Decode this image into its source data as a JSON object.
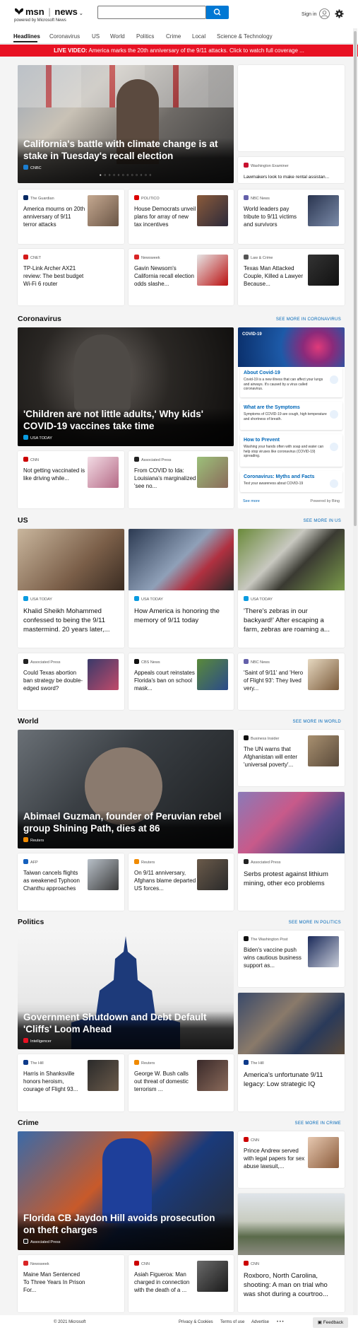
{
  "header": {
    "brand": "msn",
    "section": "news",
    "powered_by": "powered by Microsoft News",
    "search_placeholder": "",
    "sign_in": "Sign in"
  },
  "nav": {
    "items": [
      "Headlines",
      "Coronavirus",
      "US",
      "World",
      "Politics",
      "Crime",
      "Local",
      "Science & Technology"
    ]
  },
  "breaking": {
    "label": "LIVE VIDEO:",
    "text": "America marks the 20th anniversary of the 9/11 attacks. Click to watch full coverage ..."
  },
  "headlines": {
    "hero": {
      "title": "California's battle with climate change is at stake in Tuesday's recall election",
      "source": "CNBC"
    },
    "side": {
      "source": "Washington Examiner",
      "title": "Lawmakers look to make rental assistan..."
    },
    "cards": [
      {
        "source": "The Guardian",
        "title": "America mourns on 20th anniversary of 9/11 terror attacks"
      },
      {
        "source": "POLITICO",
        "title": "House Democrats unveil plans for array of new tax incentives"
      },
      {
        "source": "NBC News",
        "title": "World leaders pay tribute to 9/11 victims and survivors"
      },
      {
        "source": "CNET",
        "title": "TP-Link Archer AX21 review: The best budget Wi-Fi 6 router"
      },
      {
        "source": "Newsweek",
        "title": "Gavin Newsom's California recall election odds slashe..."
      },
      {
        "source": "Law & Crime",
        "title": "Texas Man Attacked Couple, Killed a Lawyer Because..."
      }
    ]
  },
  "coronavirus": {
    "heading": "Coronavirus",
    "see_more": "SEE MORE IN CORONAVIRUS",
    "hero": {
      "title": "'Children are not little adults,' Why kids' COVID-19 vaccines take time",
      "source": "USA TODAY"
    },
    "cards": [
      {
        "source": "CNN",
        "title": "Not getting vaccinated is like driving while..."
      },
      {
        "source": "Associated Press",
        "title": "From COVID to Ida: Louisiana's marginalized 'see no..."
      }
    ],
    "panel": {
      "tag": "COVID-19",
      "items": [
        {
          "heading": "About Covid-19",
          "desc": "Covid-19 is a new illness that can affect your lungs and airways. It's caused by a virus called coronavirus."
        },
        {
          "heading": "What are the Symptoms",
          "desc": "Symptoms of COVID-19 are cough, high temperature and shortness of breath."
        },
        {
          "heading": "How to Prevent",
          "desc": "Washing your hands often with soap and water can help stop viruses like coronavirus (COVID-19) spreading."
        },
        {
          "heading": "Coronavirus: Myths and Facts",
          "desc": "Test your awareness about COVID-19"
        }
      ],
      "see_more": "See more",
      "powered": "Powered by Bing"
    }
  },
  "us": {
    "heading": "US",
    "see_more": "SEE MORE IN US",
    "big": [
      {
        "source": "USA TODAY",
        "title": "Khalid Sheikh Mohammed confessed to being the 9/11 mastermind. 20 years later,..."
      },
      {
        "source": "USA TODAY",
        "title": "How America is honoring the memory of 9/11 today"
      },
      {
        "source": "USA TODAY",
        "title": "'There's zebras in our backyard!' After escaping a farm, zebras are roaming a..."
      }
    ],
    "cards": [
      {
        "source": "Associated Press",
        "title": "Could Texas abortion ban strategy be double-edged sword?"
      },
      {
        "source": "CBS News",
        "title": "Appeals court reinstates Florida's ban on school mask..."
      },
      {
        "source": "NBC News",
        "title": "'Saint of 9/11' and 'Hero of Flight 93': They lived very..."
      }
    ]
  },
  "world": {
    "heading": "World",
    "see_more": "SEE MORE IN WORLD",
    "hero": {
      "title": "Abimael Guzman, founder of Peruvian rebel group Shining Path, dies at 86",
      "source": "Reuters"
    },
    "side": {
      "source": "Business Insider",
      "title": "The UN warns that Afghanistan will enter 'universal poverty'..."
    },
    "side_big": {
      "source": "Associated Press",
      "title": "Serbs protest against lithium mining, other eco problems"
    },
    "cards": [
      {
        "source": "AFP",
        "title": "Taiwan cancels flights as weakened Typhoon Chanthu approaches"
      },
      {
        "source": "Reuters",
        "title": "On 9/11 anniversary, Afghans blame departed US forces..."
      }
    ]
  },
  "politics": {
    "heading": "Politics",
    "see_more": "SEE MORE IN POLITICS",
    "hero": {
      "title": "Government Shutdown and Debt Default 'Cliffs' Loom Ahead",
      "source": "Intelligencer"
    },
    "side": {
      "source": "The Washington Post",
      "title": "Biden's vaccine push wins cautious business support as..."
    },
    "side_big": {
      "source": "The Hill",
      "title": "America's unfortunate 9/11 legacy: Low strategic IQ"
    },
    "cards": [
      {
        "source": "The Hill",
        "title": "Harris in Shanksville honors heroism, courage of Flight 93..."
      },
      {
        "source": "Reuters",
        "title": "George W. Bush calls out threat of domestic terrorism ..."
      }
    ]
  },
  "crime": {
    "heading": "Crime",
    "see_more": "SEE MORE IN CRIME",
    "hero": {
      "title": "Florida CB Jaydon Hill avoids prosecution on theft charges",
      "source": "Associated Press"
    },
    "side": {
      "source": "CNN",
      "title": "Prince Andrew served with legal papers for sex abuse lawsuit,..."
    },
    "side_big": {
      "source": "CNN",
      "title": "Roxboro, North Carolina, shooting: A man on trial who was shot during a courtroo..."
    },
    "cards": [
      {
        "source": "Newsweek",
        "title": "Maine Man Sentenced To Three Years In Prison For..."
      },
      {
        "source": "CNN",
        "title": "Asiah Figueroa: Man charged in connection with the death of a ..."
      }
    ]
  },
  "footer": {
    "copyright": "© 2021 Microsoft",
    "links": [
      "Privacy & Cookies",
      "Terms of use",
      "Advertise"
    ],
    "more": "• • •",
    "feedback": "Feedback"
  },
  "colors": {
    "accent": "#0078d4",
    "breaking": "#e81123"
  }
}
